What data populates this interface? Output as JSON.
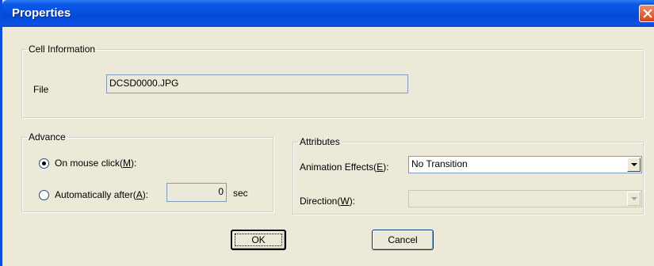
{
  "window": {
    "title": "Properties"
  },
  "cell_info": {
    "legend": "Cell Information",
    "file_label": "File",
    "file_value": "DCSD0000.JPG"
  },
  "advance": {
    "legend": "Advance",
    "on_click_label_pre": "On mouse click(",
    "on_click_key": "M",
    "on_click_label_post": "):",
    "on_click_selected": true,
    "auto_label_pre": "Automatically after(",
    "auto_key": "A",
    "auto_label_post": "):",
    "auto_value": "0",
    "auto_unit": "sec"
  },
  "attributes": {
    "legend": "Attributes",
    "effects_label_pre": "Animation Effects(",
    "effects_key": "E",
    "effects_label_post": "):",
    "effects_value": "No Transition",
    "direction_label_pre": "Direction(",
    "direction_key": "W",
    "direction_label_post": "):",
    "direction_value": ""
  },
  "buttons": {
    "ok": "OK",
    "cancel": "Cancel"
  }
}
